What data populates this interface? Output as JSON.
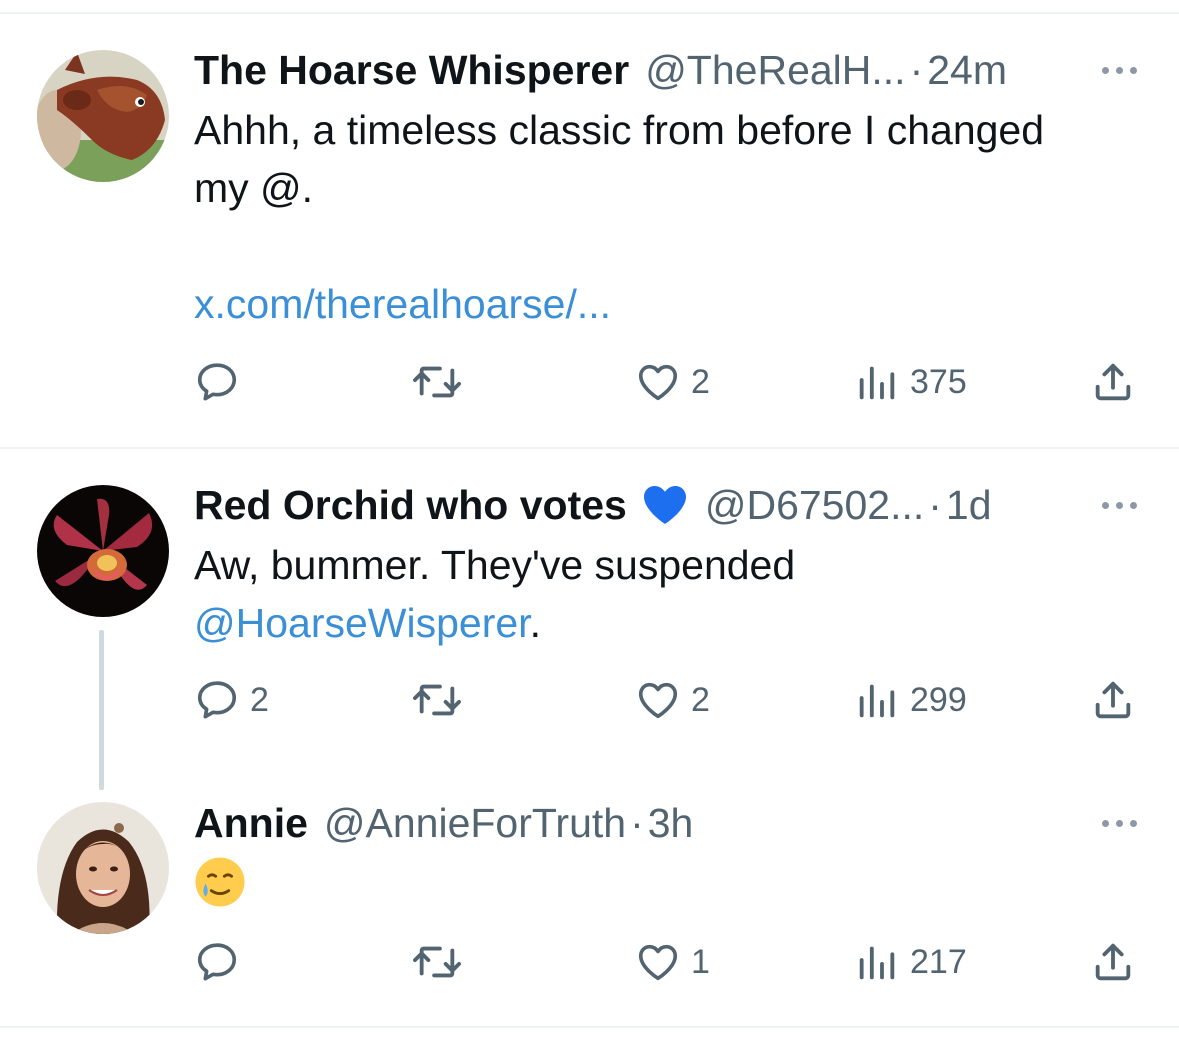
{
  "tweets": [
    {
      "name": "The Hoarse Whisperer",
      "handle": "@TheRealH...",
      "sep": "·",
      "time": "24m",
      "text_line1": "Ahhh, a timeless classic from before I changed",
      "text_line2": "my @.",
      "link": "x.com/therealhoarse/...",
      "replies": "",
      "likes": "2",
      "views": "375"
    },
    {
      "name": "Red Orchid who votes",
      "handle": "@D67502...",
      "sep": "·",
      "time": "1d",
      "text_line1": "Aw, bummer.  They've suspended",
      "mention": "@HoarseWisperer",
      "mention_suffix": ".",
      "replies": "2",
      "likes": "2",
      "views": "299"
    },
    {
      "name": "Annie",
      "handle": "@AnnieForTruth",
      "sep": "·",
      "time": "3h",
      "replies": "",
      "likes": "1",
      "views": "217"
    }
  ],
  "icons": {
    "reply": "reply-icon",
    "retweet": "retweet-icon",
    "like": "heart-icon",
    "views": "views-icon",
    "share": "share-icon",
    "more": "more-icon",
    "blue_heart": "blue-heart-emoji",
    "crying_face": "smiling-face-with-tear-emoji"
  },
  "colors": {
    "text": "#0f1419",
    "secondary": "#536471",
    "link": "#3a8fd6",
    "divider": "#eff3f4",
    "blue_heart": "#1d6ff0"
  }
}
